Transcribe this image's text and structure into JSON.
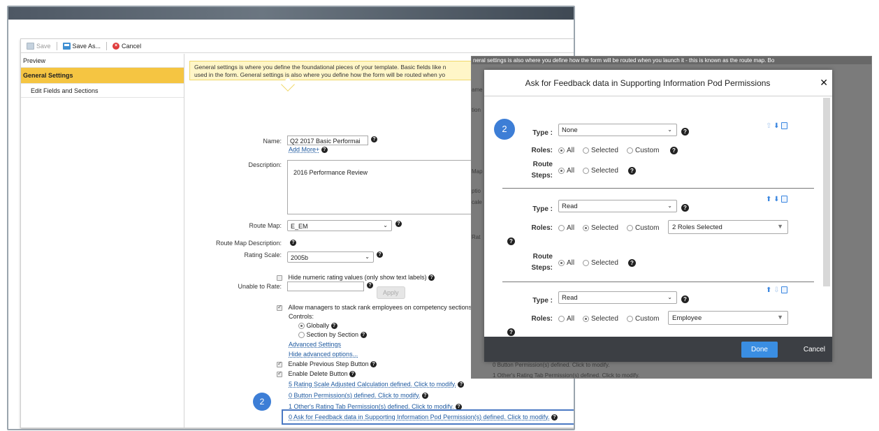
{
  "toolbar": {
    "save": "Save",
    "save_as": "Save As...",
    "cancel": "Cancel"
  },
  "nav": {
    "preview": "Preview",
    "general_settings": "General Settings",
    "edit_fields": "Edit Fields and Sections"
  },
  "info_bar": {
    "line1": "General settings is where you define the foundational pieces of your template. Basic fields like n",
    "line2": "used in the form. General settings is also where you define how the form will be routed when yo"
  },
  "form": {
    "name_label": "Name:",
    "name_value": "Q2 2017 Basic Performai",
    "add_more": "Add More+",
    "description_label": "Description:",
    "description_value": "2016 Performance Review",
    "route_map_label": "Route Map:",
    "route_map_value": "E_EM",
    "route_map_desc_label": "Route Map Description:",
    "rating_scale_label": "Rating Scale:",
    "rating_scale_value": "2005b",
    "hide_numeric": "Hide numeric rating values (only show text labels)",
    "unable_label": "Unable to Rate:",
    "apply": "Apply",
    "allow_stack": "Allow managers to stack rank employees on competency sections",
    "controls": "Controls:",
    "globally": "Globally",
    "section_by_section": "Section by Section",
    "advanced_settings": "Advanced Settings",
    "hide_advanced": "Hide advanced options...",
    "enable_prev": "Enable Previous Step Button",
    "enable_delete": "Enable Delete Button",
    "link_rating_scale": "5 Rating Scale Adjusted Calculation defined. Click to modify.",
    "link_button_perm": "0 Button Permission(s) defined. Click to modify.",
    "link_others_rating": "1 Other's Rating Tab Permission(s) defined. Click to modify.",
    "link_ask_feedback": "0 Ask for Feedback data in Supporting Information Pod Permission(s) defined. Click to modify."
  },
  "badge_number": "2",
  "window2": {
    "strip_text": "neral settings is also where you define how the form will be routed when you launch it - this is known as the route map. Bo",
    "bg_labels": [
      "ame",
      "tion",
      "Map",
      "ptio",
      "cale",
      "Rat"
    ],
    "bg_link1": "0 Button Permission(s) defined. Click to modify.",
    "bg_link2": "1 Other's Rating Tab Permission(s) defined. Click to modify.",
    "modal": {
      "title": "Ask for Feedback data in Supporting Information Pod Permissions",
      "close": "✕",
      "badge": "2",
      "type_label": "Type :",
      "roles_label": "Roles:",
      "route_label": "Route",
      "steps_label": "Steps:",
      "opt_all": "All",
      "opt_selected": "Selected",
      "opt_custom": "Custom",
      "block1_type": "None",
      "block2_type": "Read",
      "block2_roles_select": "2 Roles Selected",
      "block3_type": "Read",
      "block3_roles_select": "Employee",
      "done": "Done",
      "cancel": "Cancel"
    }
  }
}
